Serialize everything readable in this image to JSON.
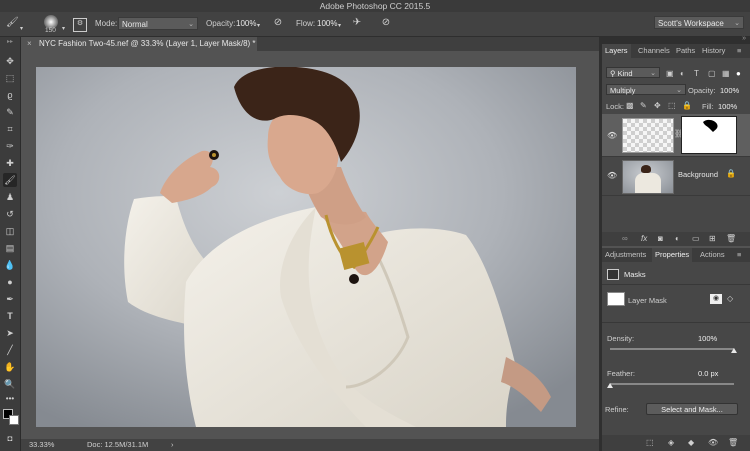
{
  "app": {
    "title": "Adobe Photoshop CC 2015.5"
  },
  "options_bar": {
    "brush_size": "150",
    "mode_label": "Mode:",
    "mode_value": "Normal",
    "opacity_label": "Opacity:",
    "opacity_value": "100%",
    "flow_label": "Flow:",
    "flow_value": "100%",
    "workspace": "Scott's Workspace"
  },
  "document": {
    "tab_close": "×",
    "tab_title": "NYC Fashion Two-45.nef @ 33.3% (Layer 1, Layer Mask/8) *"
  },
  "status_bar": {
    "zoom": "33.33%",
    "doc_info": "Doc: 12.5M/31.1M",
    "arrow": "›"
  },
  "layers_panel": {
    "tabs": [
      "Layers",
      "Channels",
      "Paths",
      "History"
    ],
    "kind_label": "Kind",
    "blend_mode": "Multiply",
    "opacity_label": "Opacity:",
    "opacity_value": "100%",
    "lock_label": "Lock:",
    "fill_label": "Fill:",
    "fill_value": "100%",
    "layers": [
      {
        "name": "",
        "visible": true,
        "selected": true
      },
      {
        "name": "Background",
        "visible": true,
        "selected": false
      }
    ],
    "footer_icons": [
      "link-icon",
      "fx-icon",
      "mask-icon",
      "adjustment-icon",
      "folder-icon",
      "new-layer-icon",
      "trash-icon"
    ],
    "fx_label": "fx"
  },
  "properties_panel": {
    "tabs": [
      "Adjustments",
      "Properties",
      "Actions"
    ],
    "section_title": "Masks",
    "mask_label": "Layer Mask",
    "density_label": "Density:",
    "density_value": "100%",
    "density_level": 1.0,
    "feather_label": "Feather:",
    "feather_value": "0.0 px",
    "feather_level": 0.0,
    "refine_label": "Refine:",
    "refine_button": "Select and Mask..."
  },
  "colors": {
    "ui_dark": "#3c3c3c",
    "ui_mid": "#474747",
    "canvas_bg": "#535353",
    "backdrop": "#aeb2b8",
    "blazer": "#ece8df",
    "hair": "#3b2418",
    "skin": "#d2a38a",
    "gold": "#b9922f"
  }
}
